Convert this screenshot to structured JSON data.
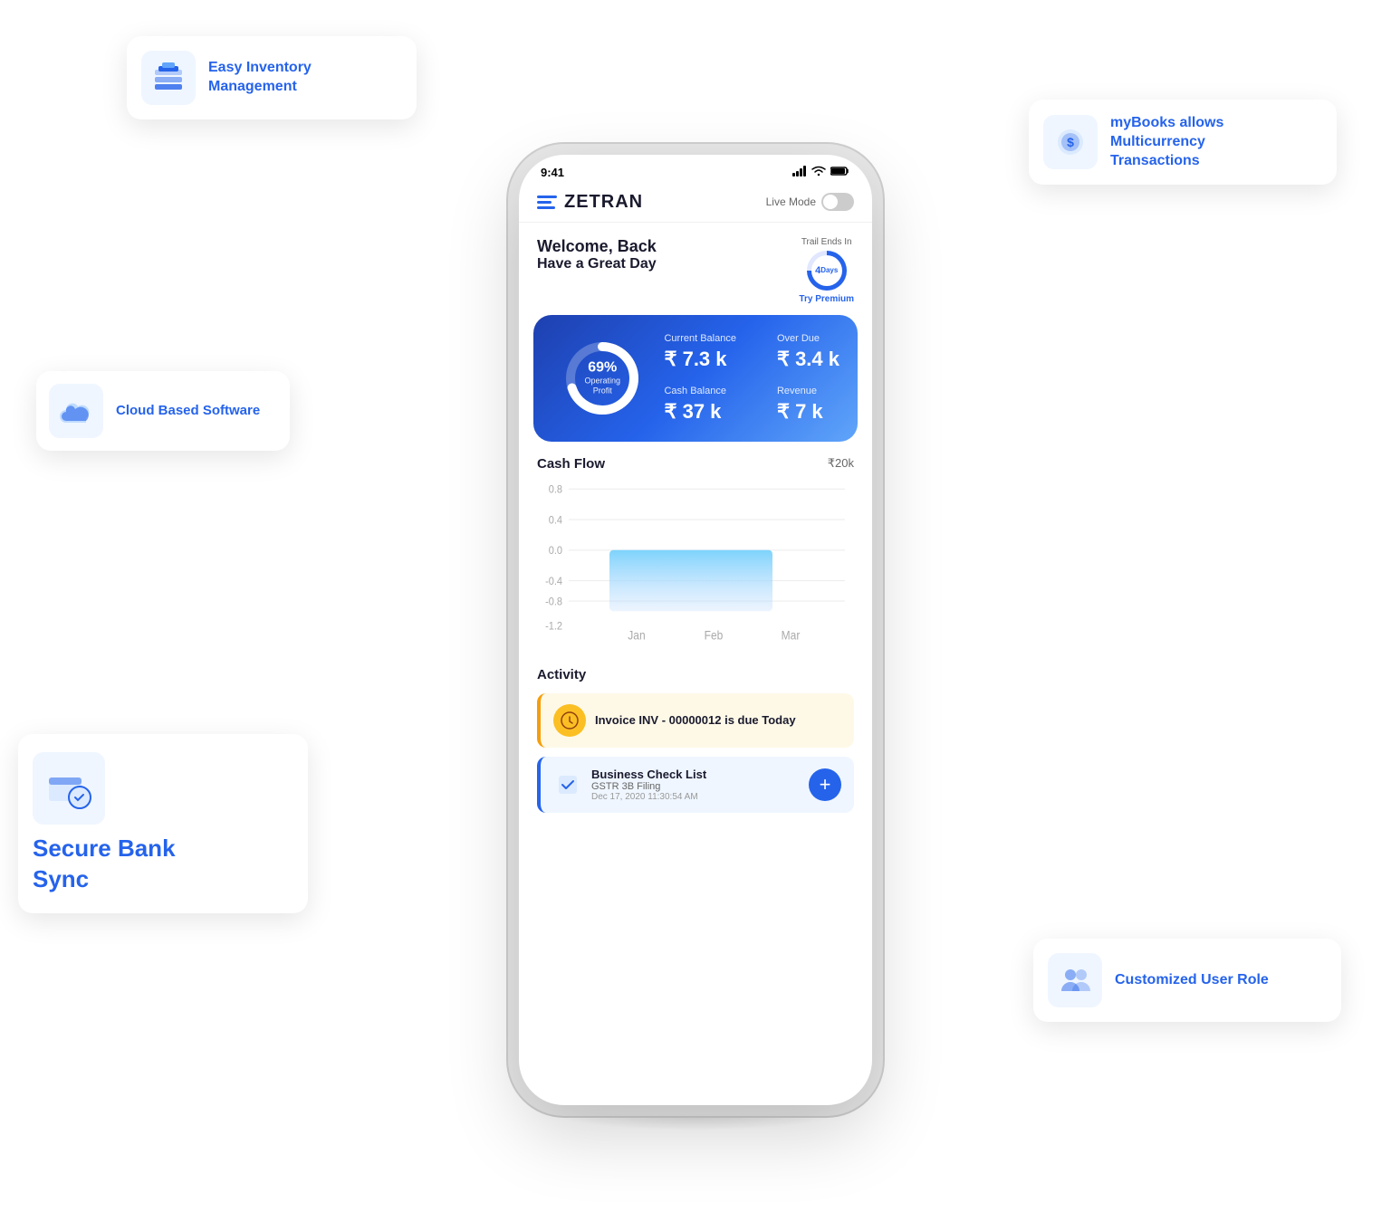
{
  "app": {
    "name": "ZETRAN",
    "status_time": "9:41",
    "live_mode_label": "Live Mode",
    "welcome_line1": "Welcome, Back",
    "welcome_line2": "Have a Great Day",
    "trial_label": "Trail Ends In",
    "trial_days": "4",
    "trial_days_unit": "Days",
    "trial_premium": "Try Premium"
  },
  "stats": {
    "current_balance_label": "Current Balance",
    "current_balance_value": "₹ 7.3 k",
    "overdue_label": "Over Due",
    "overdue_value": "₹ 3.4 k",
    "cash_balance_label": "Cash Balance",
    "cash_balance_value": "₹ 37 k",
    "revenue_label": "Revenue",
    "revenue_value": "₹ 7 k",
    "donut_percent": "69%",
    "donut_label1": "Operating",
    "donut_label2": "Profit"
  },
  "cashflow": {
    "title": "Cash Flow",
    "amount": "₹20k",
    "y_labels": [
      "0.8",
      "0.4",
      "0.0",
      "-0.4",
      "-0.8",
      "-1.2"
    ],
    "x_labels": [
      "Jan",
      "Feb",
      "Mar"
    ]
  },
  "activity": {
    "title": "Activity",
    "invoice_text": "Invoice INV - 00000012 is due Today",
    "checklist_title": "Business Check List",
    "checklist_sub": "GSTR 3B Filing",
    "checklist_date": "Dec 17, 2020 11:30:54 AM",
    "add_button": "+"
  },
  "features": {
    "inventory": {
      "icon": "📦",
      "text": "Easy Inventory\nManagement"
    },
    "multicurrency": {
      "icon": "💵",
      "text": "myBooks allows\nMulticurrency\nTransactions"
    },
    "cloud": {
      "icon": "☁️",
      "text": "Cloud Based Software"
    },
    "bank": {
      "icon": "🖥️",
      "text": "Secure Bank\nSync"
    },
    "userrole": {
      "icon": "👥",
      "text": "Customized User Role"
    }
  }
}
